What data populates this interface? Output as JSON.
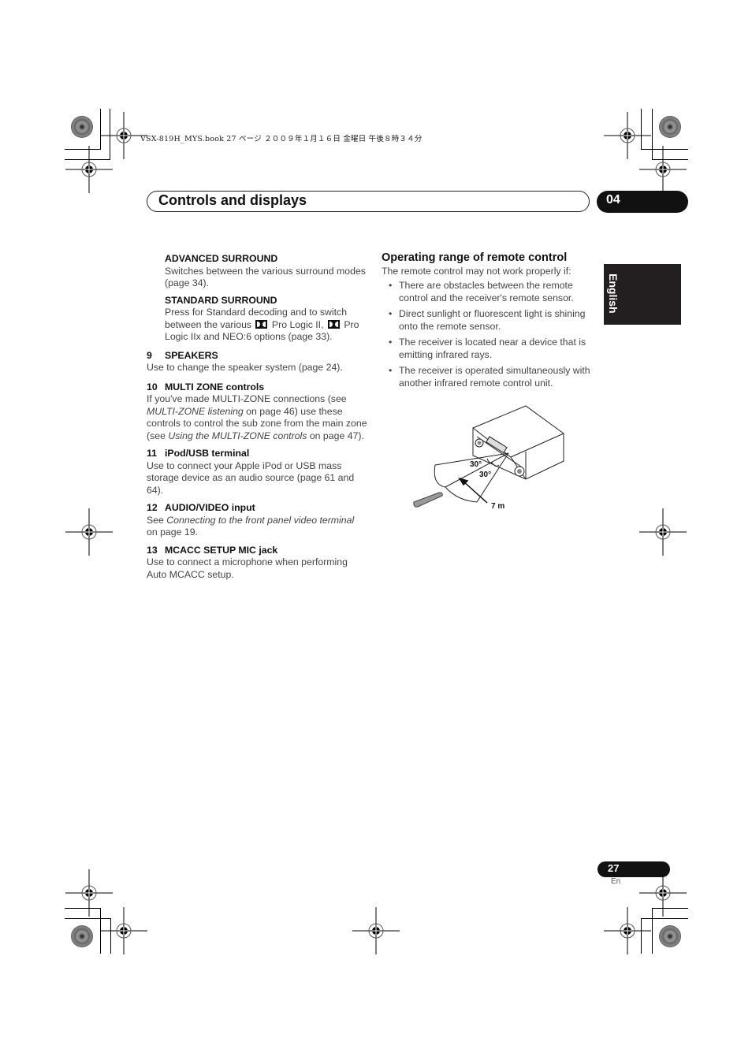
{
  "print_header": "VSX-819H_MYS.book  27 ページ  ２００９年１月１６日  金曜日  午後８時３４分",
  "section": {
    "title": "Controls and displays",
    "chapter": "04"
  },
  "language_tab": "English",
  "left_column": {
    "items": [
      {
        "number": "",
        "heading": "ADVANCED SURROUND",
        "text": "Switches between the various surround modes (page 34)."
      },
      {
        "number": "",
        "heading": "STANDARD SURROUND",
        "text_parts": [
          "Press for Standard decoding and to switch between the various ",
          " Pro Logic II, ",
          " Pro Logic IIx and NEO:6 options (page 33)."
        ]
      },
      {
        "number": "9",
        "heading": "SPEAKERS",
        "text": "Use to change the speaker system (page 24)."
      },
      {
        "number": "10",
        "heading": "MULTI ZONE controls",
        "text_parts": [
          "If you've made MULTI-ZONE connections (see ",
          "MULTI-ZONE listening",
          " on page 46) use these controls to control the sub zone from the main zone (see ",
          "Using the MULTI-ZONE controls",
          " on page 47)."
        ]
      },
      {
        "number": "11",
        "heading": "iPod/USB terminal",
        "text": "Use to connect your Apple iPod or USB mass storage device as an audio source (page 61 and 64)."
      },
      {
        "number": "12",
        "heading": "AUDIO/VIDEO input",
        "text_parts": [
          "See ",
          "Connecting to the front panel video terminal",
          " on page 19."
        ]
      },
      {
        "number": "13",
        "heading": "MCACC SETUP MIC jack",
        "text": "Use to connect a microphone when performing Auto MCACC setup."
      }
    ]
  },
  "right_column": {
    "heading": "Operating range of remote control",
    "intro": "The remote control may not work properly if:",
    "bullets": [
      "There are obstacles between the remote control and the receiver's remote sensor.",
      "Direct sunlight or fluorescent light is shining onto the remote sensor.",
      "The receiver is located near a device that is emitting infrared rays.",
      "The receiver is operated simultaneously with another infrared remote control unit."
    ],
    "figure": {
      "angle_top": "30°",
      "angle_bottom": "30°",
      "distance": "7 m"
    }
  },
  "footer": {
    "page_number": "27",
    "language_code": "En"
  }
}
